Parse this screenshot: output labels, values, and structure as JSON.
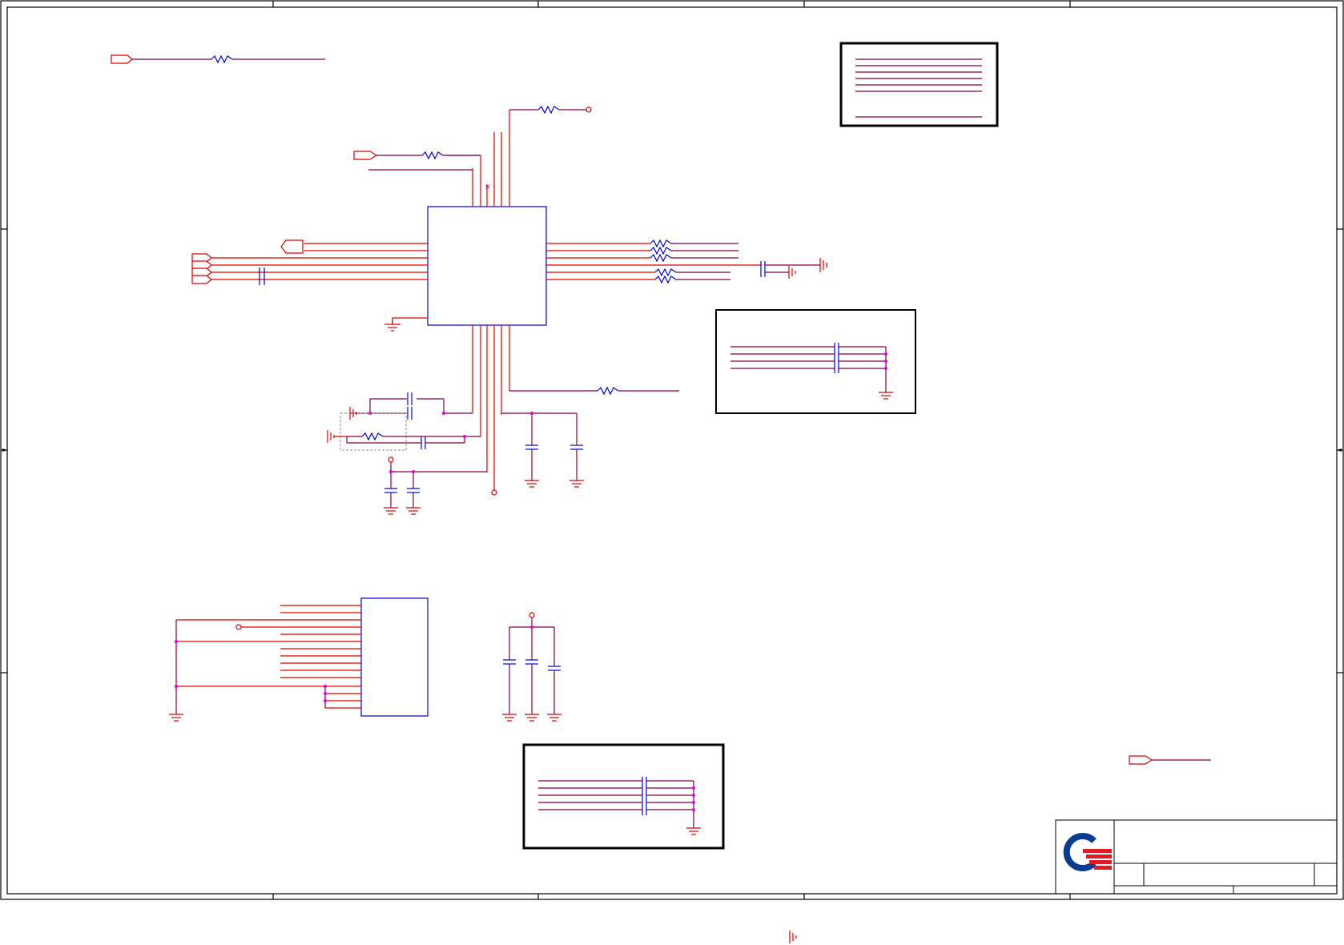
{
  "document": {
    "title_block": {
      "logo": "quanta-logo",
      "logo_colors": {
        "ring": "#0a3d91",
        "stripes": "#e01b24"
      }
    }
  },
  "colors": {
    "wire": "#800040",
    "pin": "#e00000",
    "component": "#0000e0",
    "junction": "#e000e0",
    "frame": "#000000"
  },
  "icons": {
    "resistor": "resistor-icon",
    "capacitor": "capacitor-icon",
    "ground": "ground-icon",
    "port": "port-flag-icon",
    "junction": "junction-dot-icon"
  }
}
